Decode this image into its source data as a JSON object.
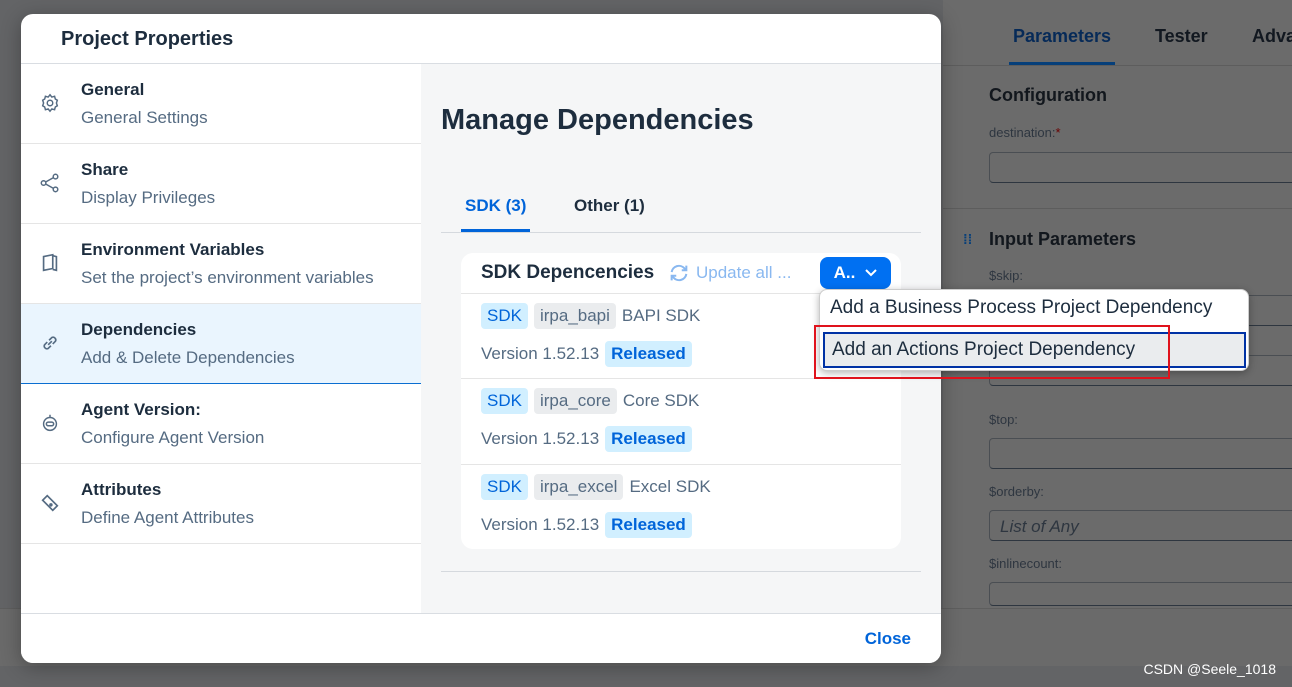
{
  "background": {
    "tabs": [
      "Parameters",
      "Tester",
      "Adva"
    ],
    "configuration_title": "Configuration",
    "destination_label": "destination:",
    "required_marker": "*",
    "input_parameters_title": "Input Parameters",
    "fields": [
      {
        "label": "$skip:",
        "value": ""
      },
      {
        "label": "$top:",
        "value": ""
      },
      {
        "label": "$orderby:",
        "placeholder": "List of Any"
      },
      {
        "label": "$inlinecount:",
        "value": ""
      }
    ]
  },
  "dialog": {
    "title": "Project Properties",
    "nav": [
      {
        "title": "General",
        "subtitle": "General Settings",
        "icon": "gear-icon"
      },
      {
        "title": "Share",
        "subtitle": "Display Privileges",
        "icon": "share-icon"
      },
      {
        "title": "Environment Variables",
        "subtitle": "Set the project’s environment variables",
        "icon": "copy-icon"
      },
      {
        "title": "Dependencies",
        "subtitle": "Add & Delete Dependencies",
        "icon": "link-icon",
        "selected": true
      },
      {
        "title": "Agent Version:",
        "subtitle": "Configure Agent Version",
        "icon": "robot-icon"
      },
      {
        "title": "Attributes",
        "subtitle": "Define Agent Attributes",
        "icon": "tag-icon"
      }
    ],
    "heading": "Manage Dependencies",
    "tabs": [
      {
        "label": "SDK (3)",
        "active": true
      },
      {
        "label": "Other (1)"
      }
    ],
    "card": {
      "title": "SDK Depencencies",
      "update_all": "Update all ...",
      "add_button": "A..",
      "rows": [
        {
          "type": "SDK",
          "id": "irpa_bapi",
          "name": "BAPI SDK",
          "version": "Version 1.52.13",
          "status": "Released"
        },
        {
          "type": "SDK",
          "id": "irpa_core",
          "name": "Core SDK",
          "version": "Version 1.52.13",
          "status": "Released"
        },
        {
          "type": "SDK",
          "id": "irpa_excel",
          "name": "Excel SDK",
          "version": "Version 1.52.13",
          "status": "Released"
        }
      ]
    },
    "menu": [
      "Add a Business Process Project Dependency",
      "Add an Actions Project Dependency"
    ],
    "close": "Close"
  },
  "watermark": "CSDN @Seele_1018",
  "colors": {
    "accent": "#0070f2",
    "highlight": "#e0121c"
  }
}
